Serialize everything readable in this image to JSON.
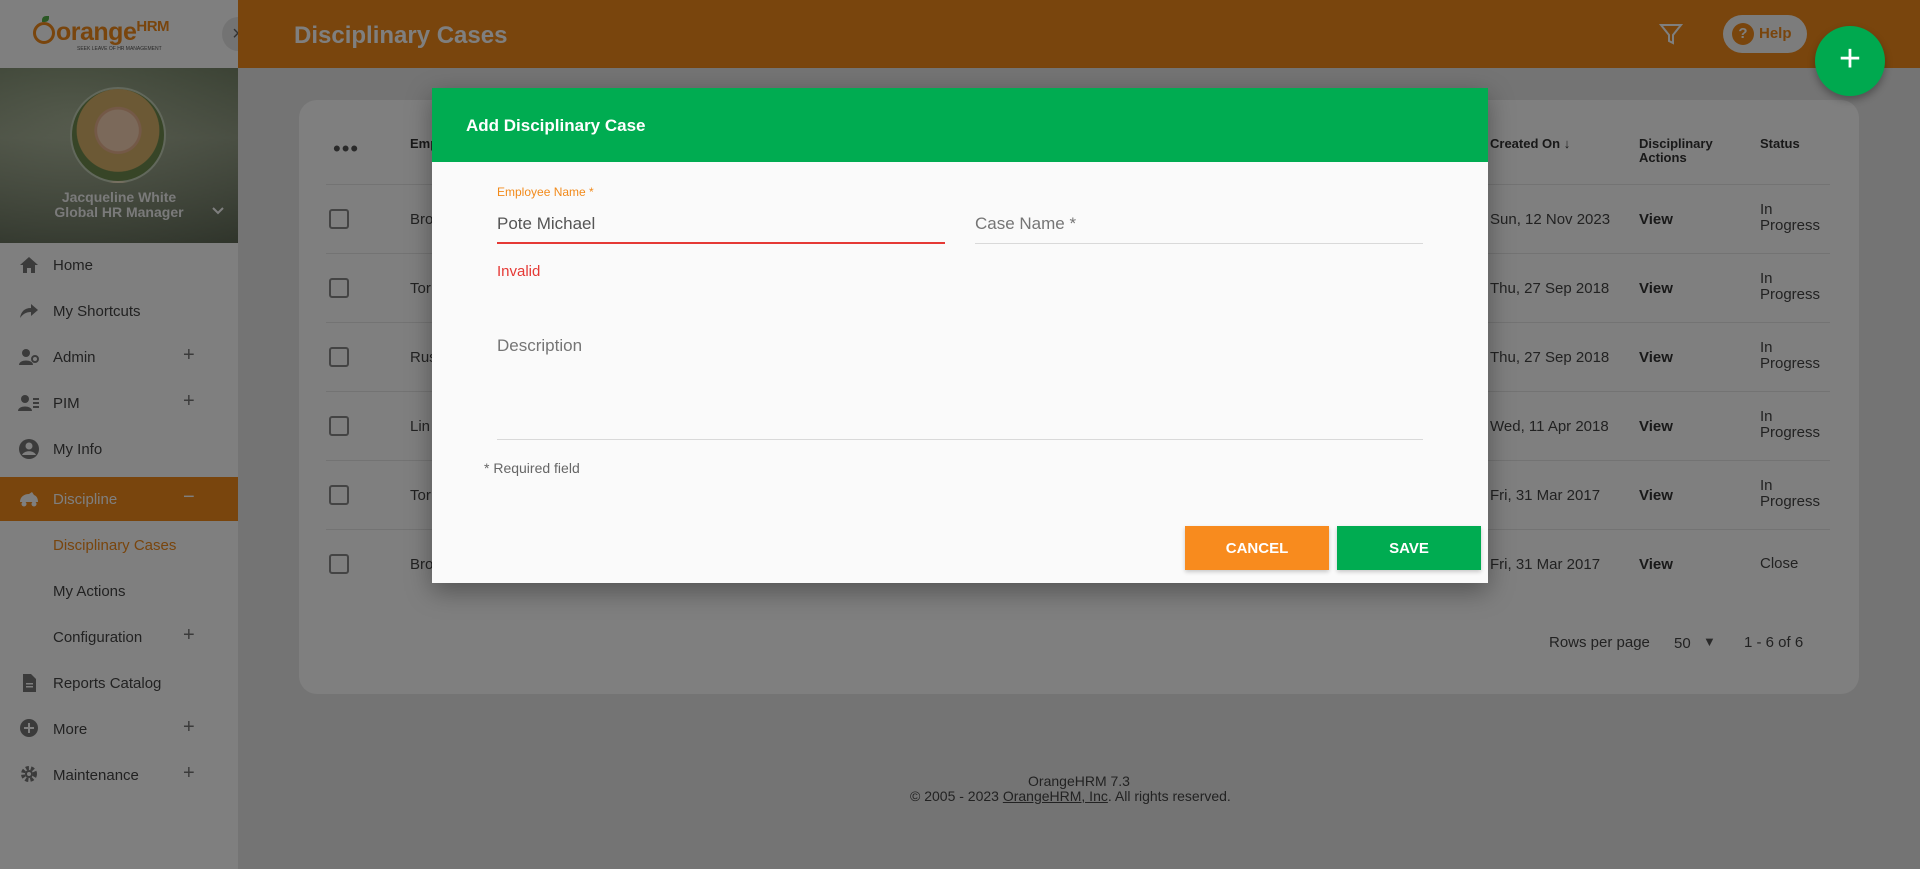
{
  "app": {
    "logo_main": "orange",
    "logo_suffix": "HRM",
    "logo_tagline": "SEEK LEAVE OF HR MANAGEMENT",
    "page_title": "Disciplinary Cases",
    "help_label": "Help"
  },
  "profile": {
    "name": "Jacqueline White",
    "role": "Global HR Manager"
  },
  "sidebar": {
    "items": [
      {
        "label": "Home",
        "icon": "home-icon"
      },
      {
        "label": "My Shortcuts",
        "icon": "share-arrow-icon"
      },
      {
        "label": "Admin",
        "icon": "admin-icon"
      },
      {
        "label": "PIM",
        "icon": "pim-icon"
      },
      {
        "label": "My Info",
        "icon": "user-circle-icon"
      },
      {
        "label": "Discipline",
        "icon": "discipline-icon"
      },
      {
        "label": "Reports Catalog",
        "icon": "document-icon"
      },
      {
        "label": "More",
        "icon": "plus-circle-icon"
      },
      {
        "label": "Maintenance",
        "icon": "gear-icon"
      }
    ],
    "discipline_sub": [
      {
        "label": "Disciplinary Cases"
      },
      {
        "label": "My Actions"
      },
      {
        "label": "Configuration"
      }
    ]
  },
  "table": {
    "headers": {
      "employee": "Emp",
      "created_on": "Created On",
      "actions": "Disciplinary Actions",
      "status": "Status"
    },
    "rows": [
      {
        "employee": "Bro",
        "created_on": "Sun, 12 Nov 2023",
        "action": "View",
        "status": "In Progress"
      },
      {
        "employee": "Tor",
        "created_on": "Thu, 27 Sep 2018",
        "action": "View",
        "status": "In Progress"
      },
      {
        "employee": "Rus",
        "created_on": "Thu, 27 Sep 2018",
        "action": "View",
        "status": "In Progress"
      },
      {
        "employee": "Lin",
        "created_on": "Wed, 11 Apr 2018",
        "action": "View",
        "status": "In Progress"
      },
      {
        "employee": "Tor",
        "created_on": "Fri, 31 Mar 2017",
        "action": "View",
        "status": "In Progress"
      },
      {
        "employee": "Bro",
        "created_on": "Fri, 31 Mar 2017",
        "action": "View",
        "status": "Close"
      }
    ],
    "rows_per_page_label": "Rows per page",
    "rows_per_page_value": "50",
    "range": "1 - 6 of 6"
  },
  "footer": {
    "version": "OrangeHRM 7.3",
    "copyright_prefix": "© 2005 - 2023 ",
    "company_link": "OrangeHRM, Inc",
    "copyright_suffix": ". All rights reserved."
  },
  "modal": {
    "title": "Add Disciplinary Case",
    "employee_label": "Employee Name *",
    "employee_value": "Pote Michael",
    "employee_error": "Invalid",
    "case_name_placeholder": "Case Name *",
    "description_placeholder": "Description",
    "required_note": "* Required field",
    "cancel_label": "CANCEL",
    "save_label": "SAVE"
  },
  "colors": {
    "accent_orange": "#f28a1a",
    "accent_green": "#00ac51",
    "error_red": "#e53935"
  }
}
